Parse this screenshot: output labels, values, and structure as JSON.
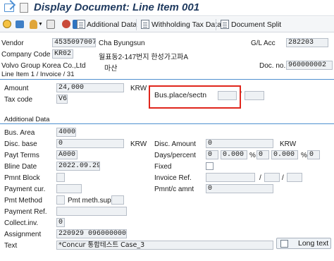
{
  "window": {
    "title": "Display Document: Line Item 001"
  },
  "toolbar": {
    "additional_data": "Additional Data",
    "withholding_tax": "Withholding Tax Data",
    "document_split": "Document Split"
  },
  "header": {
    "vendor_label": "Vendor",
    "vendor_value": "4535097007",
    "vendor_name": "Cha Byungsun",
    "gl_acc_label": "G/L Acc",
    "gl_acc_value": "282203",
    "company_code_label": "Company Code",
    "company_code_value": "KR02",
    "address_line": "월표동2-147번지 한성가고파A",
    "company_name": "Volvo Group Korea Co.,Ltd",
    "city": "마산",
    "doc_no_label": "Doc. no.",
    "doc_no_value": "960000002"
  },
  "line_item": {
    "section_title": "Line Item 1 / Invoice / 31",
    "amount_label": "Amount",
    "amount_value": "24,000",
    "currency": "KRW",
    "tax_code_label": "Tax code",
    "tax_code_value": "V6",
    "bus_place_label": "Bus.place/sectn",
    "bus_place_separator": "/"
  },
  "additional": {
    "section_title": "Additional Data",
    "bus_area_label": "Bus. Area",
    "bus_area_value": "4000",
    "disc_base_label": "Disc. base",
    "disc_base_value": "0",
    "disc_base_currency": "KRW",
    "disc_amount_label": "Disc. Amount",
    "disc_amount_value": "0",
    "disc_amount_currency": "KRW",
    "payt_terms_label": "Payt Terms",
    "payt_terms_value": "A000",
    "days_percent_label": "Days/percent",
    "days1": "0",
    "percent1": "0.000",
    "percent_sign": "%",
    "days2": "0",
    "percent2": "0.000",
    "days3": "0",
    "bline_date_label": "Bline Date",
    "bline_date_value": "2022.09.29",
    "fixed_label": "Fixed",
    "pmnt_block_label": "Pmnt Block",
    "invoice_ref_label": "Invoice Ref.",
    "invoice_ref_sep": "/",
    "payment_cur_label": "Payment cur.",
    "pmnt_c_amnt_label": "Pmnt/c amnt",
    "pmnt_c_amnt_value": "0",
    "pmt_method_label": "Pmt Method",
    "pmt_meth_supl_label": "Pmt meth.supl.",
    "payment_ref_label": "Payment Ref.",
    "collect_inv_label": "Collect.inv.",
    "collect_inv_value": "0",
    "assignment_label": "Assignment",
    "assignment_value": "220929 0960000002",
    "text_label": "Text",
    "text_value": "*Concur 통합테스트 Case_3",
    "long_text_button": "Long text"
  }
}
